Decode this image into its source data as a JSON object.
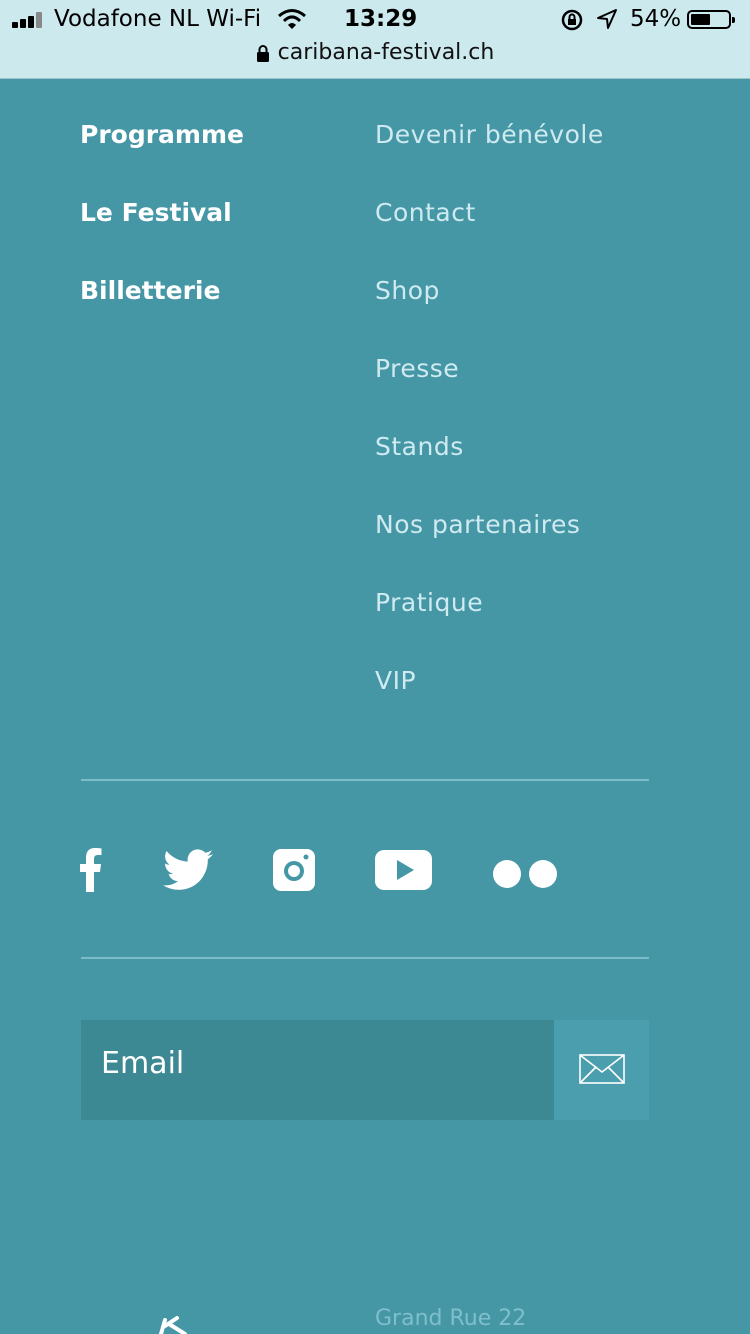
{
  "status_bar": {
    "carrier": "Vodafone NL Wi-Fi",
    "time": "13:29",
    "battery": "54%",
    "battery_level": 0.54,
    "icons": [
      "signal-icon",
      "wifi-icon",
      "rotation-lock-icon",
      "location-icon",
      "battery-icon"
    ]
  },
  "browser": {
    "url": "caribana-festival.ch",
    "icon": "lock-icon"
  },
  "footer": {
    "primary_links": [
      "Programme",
      "Le Festival",
      "Billetterie"
    ],
    "secondary_links": [
      "Devenir bénévole",
      "Contact",
      "Shop",
      "Presse",
      "Stands",
      "Nos partenaires",
      "Pratique",
      "VIP"
    ],
    "social": [
      "facebook-icon",
      "twitter-icon",
      "instagram-icon",
      "youtube-icon",
      "flickr-icon"
    ],
    "newsletter": {
      "placeholder": "Email",
      "button_icon": "envelope-icon"
    },
    "address_line": "Grand Rue 22"
  },
  "colors": {
    "background": "#4597a6",
    "input": "#3d8993",
    "secondary_text": "#cfeaf0",
    "topbar": "#cce9ee"
  }
}
